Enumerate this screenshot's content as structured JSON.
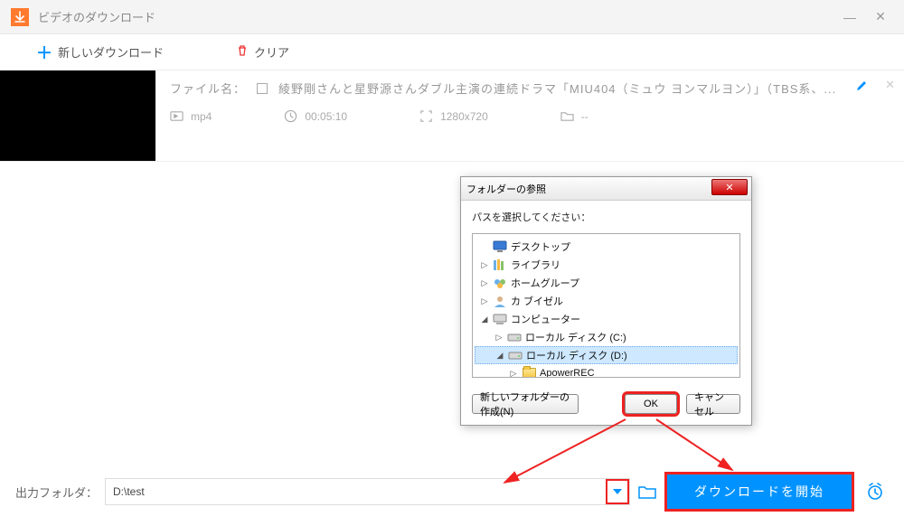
{
  "titlebar": {
    "title": "ビデオのダウンロード"
  },
  "toolbar": {
    "new_label": "新しいダウンロード",
    "clear_label": "クリア"
  },
  "download_item": {
    "filename_prefix": "ファイル名：",
    "filename": "綾野剛さんと星野源さんダブル主演の連続ドラマ「MIU404（ミュウ ヨンマルヨン）」（TBS系、...",
    "format": "mp4",
    "duration": "00:05:10",
    "resolution": "1280x720",
    "dest": "--"
  },
  "output": {
    "label": "出力フォルダ：",
    "path": "D:\\test"
  },
  "start_button": "ダウンロードを開始",
  "dialog": {
    "title": "フォルダーの参照",
    "hint": "パスを選択してください：",
    "tree": [
      {
        "indent": 0,
        "expand": "",
        "icon": "desktop",
        "label": "デスクトップ"
      },
      {
        "indent": 0,
        "expand": "▷",
        "icon": "library",
        "label": "ライブラリ"
      },
      {
        "indent": 0,
        "expand": "▷",
        "icon": "homegroup",
        "label": "ホームグループ"
      },
      {
        "indent": 0,
        "expand": "▷",
        "icon": "user",
        "label": "カ ブイゼル"
      },
      {
        "indent": 0,
        "expand": "◢",
        "icon": "computer",
        "label": "コンピューター"
      },
      {
        "indent": 1,
        "expand": "▷",
        "icon": "drive",
        "label": "ローカル ディスク (C:)"
      },
      {
        "indent": 1,
        "expand": "◢",
        "icon": "drive",
        "label": "ローカル ディスク (D:)",
        "selected": true
      },
      {
        "indent": 2,
        "expand": "▷",
        "icon": "folder",
        "label": "ApowerREC"
      }
    ],
    "new_folder": "新しいフォルダーの作成(N)",
    "ok": "OK",
    "cancel": "キャンセル"
  }
}
